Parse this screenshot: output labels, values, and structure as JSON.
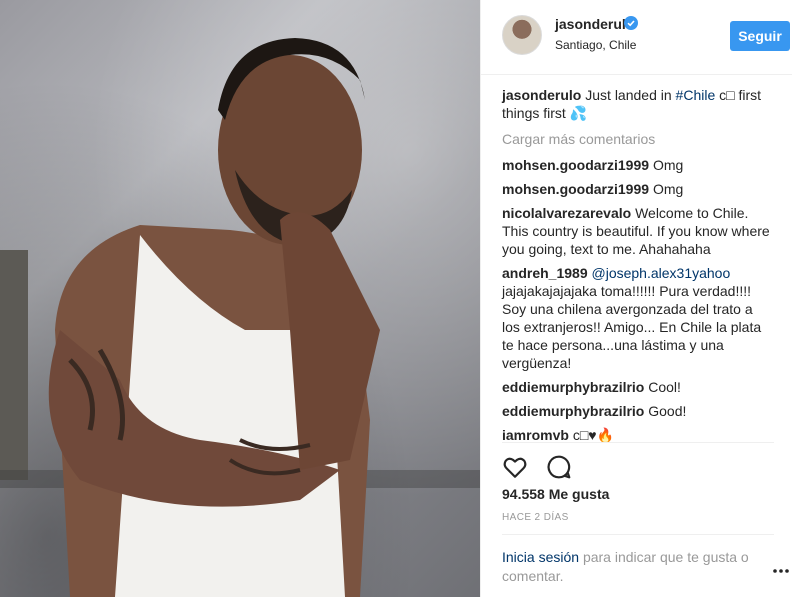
{
  "header": {
    "username": "jasonderulo",
    "location": "Santiago, Chile",
    "follow_label": "Seguir"
  },
  "caption": {
    "username": "jasonderulo",
    "text_before": "Just landed in",
    "hashtag": "#Chile",
    "text_after": "c□ first things first 💦"
  },
  "load_more_label": "Cargar más comentarios",
  "comments": [
    {
      "username": "mohsen.goodarzi1999",
      "text": "Omg"
    },
    {
      "username": "mohsen.goodarzi1999",
      "text": "Omg"
    },
    {
      "username": "nicolalvarezarevalo",
      "text": "Welcome to Chile. This country is beautiful. If you know where you going, text to me. Ahahahaha"
    },
    {
      "username": "andreh_1989",
      "mention": "@joseph.alex31yahoo",
      "text": "jajajakajajajaka toma!!!!!! Pura verdad!!!! Soy una chilena avergonzada del trato a los extranjeros!! Amigo... En Chile la plata te hace persona...una lástima y una vergüenza!"
    },
    {
      "username": "eddiemurphybrazilrio",
      "text": "Cool!"
    },
    {
      "username": "eddiemurphybrazilrio",
      "text": "Good!"
    },
    {
      "username": "iamromvb",
      "text": "c□♥🔥"
    }
  ],
  "likes": "94.558 Me gusta",
  "time_ago": "HACE 2 DÍAS",
  "login": {
    "link": "Inicia sesión",
    "text": "para indicar que te gusta o comentar."
  },
  "icons": {
    "verified": "verified-badge-icon",
    "like": "heart-icon",
    "comment": "comment-icon",
    "more": "more-options-icon"
  },
  "colors": {
    "accent": "#3897f0",
    "link": "#003569",
    "muted": "#999999"
  }
}
